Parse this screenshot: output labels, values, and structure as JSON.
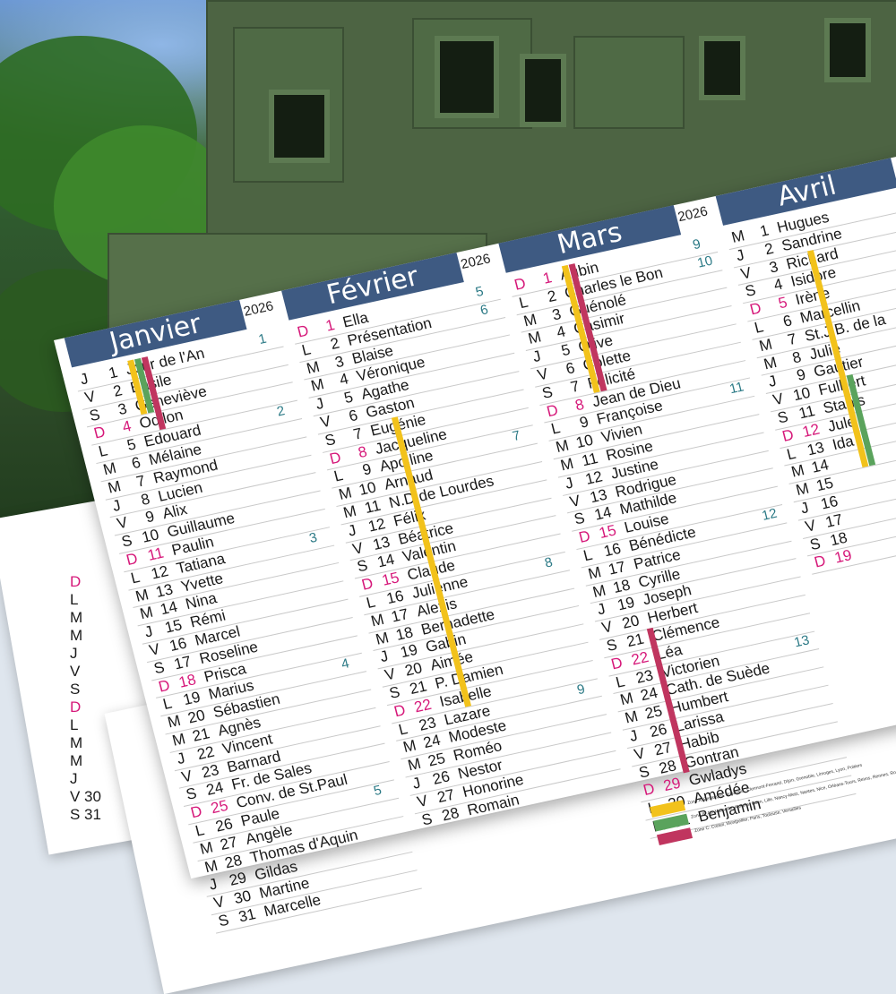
{
  "year": "2026",
  "months": [
    {
      "name": "Janvier",
      "days": [
        {
          "l": "J",
          "n": "1",
          "s": "Jour de l'An"
        },
        {
          "l": "V",
          "n": "2",
          "s": "Basile"
        },
        {
          "l": "S",
          "n": "3",
          "s": "Geneviève"
        },
        {
          "l": "D",
          "n": "4",
          "s": "Odilon"
        },
        {
          "l": "L",
          "n": "5",
          "s": "Edouard"
        },
        {
          "l": "M",
          "n": "6",
          "s": "Mélaine"
        },
        {
          "l": "M",
          "n": "7",
          "s": "Raymond"
        },
        {
          "l": "J",
          "n": "8",
          "s": "Lucien"
        },
        {
          "l": "V",
          "n": "9",
          "s": "Alix"
        },
        {
          "l": "S",
          "n": "10",
          "s": "Guillaume"
        },
        {
          "l": "D",
          "n": "11",
          "s": "Paulin"
        },
        {
          "l": "L",
          "n": "12",
          "s": "Tatiana"
        },
        {
          "l": "M",
          "n": "13",
          "s": "Yvette"
        },
        {
          "l": "M",
          "n": "14",
          "s": "Nina"
        },
        {
          "l": "J",
          "n": "15",
          "s": "Rémi"
        },
        {
          "l": "V",
          "n": "16",
          "s": "Marcel"
        },
        {
          "l": "S",
          "n": "17",
          "s": "Roseline"
        },
        {
          "l": "D",
          "n": "18",
          "s": "Prisca"
        },
        {
          "l": "L",
          "n": "19",
          "s": "Marius"
        },
        {
          "l": "M",
          "n": "20",
          "s": "Sébastien"
        },
        {
          "l": "M",
          "n": "21",
          "s": "Agnès"
        },
        {
          "l": "J",
          "n": "22",
          "s": "Vincent"
        },
        {
          "l": "V",
          "n": "23",
          "s": "Barnard"
        },
        {
          "l": "S",
          "n": "24",
          "s": "Fr. de Sales"
        },
        {
          "l": "D",
          "n": "25",
          "s": "Conv. de St.Paul"
        },
        {
          "l": "L",
          "n": "26",
          "s": "Paule"
        },
        {
          "l": "M",
          "n": "27",
          "s": "Angèle"
        },
        {
          "l": "M",
          "n": "28",
          "s": "Thomas d'Aquin"
        },
        {
          "l": "J",
          "n": "29",
          "s": "Gildas"
        },
        {
          "l": "V",
          "n": "30",
          "s": "Martine"
        },
        {
          "l": "S",
          "n": "31",
          "s": "Marcelle"
        }
      ],
      "weeks": [
        {
          "w": "1",
          "row": 0
        },
        {
          "w": "2",
          "row": 4
        },
        {
          "w": "3",
          "row": 11
        },
        {
          "w": "4",
          "row": 18
        },
        {
          "w": "5",
          "row": 25
        }
      ]
    },
    {
      "name": "Février",
      "days": [
        {
          "l": "D",
          "n": "1",
          "s": "Ella"
        },
        {
          "l": "L",
          "n": "2",
          "s": "Présentation"
        },
        {
          "l": "M",
          "n": "3",
          "s": "Blaise"
        },
        {
          "l": "M",
          "n": "4",
          "s": "Véronique"
        },
        {
          "l": "J",
          "n": "5",
          "s": "Agathe"
        },
        {
          "l": "V",
          "n": "6",
          "s": "Gaston"
        },
        {
          "l": "S",
          "n": "7",
          "s": "Eugénie"
        },
        {
          "l": "D",
          "n": "8",
          "s": "Jacqueline"
        },
        {
          "l": "L",
          "n": "9",
          "s": "Apolline"
        },
        {
          "l": "M",
          "n": "10",
          "s": "Arnaud"
        },
        {
          "l": "M",
          "n": "11",
          "s": "N.D de Lourdes"
        },
        {
          "l": "J",
          "n": "12",
          "s": "Félix"
        },
        {
          "l": "V",
          "n": "13",
          "s": "Béatrice"
        },
        {
          "l": "S",
          "n": "14",
          "s": "Valentin"
        },
        {
          "l": "D",
          "n": "15",
          "s": "Claude"
        },
        {
          "l": "L",
          "n": "16",
          "s": "Julienne"
        },
        {
          "l": "M",
          "n": "17",
          "s": "Alexis"
        },
        {
          "l": "M",
          "n": "18",
          "s": "Bernadette"
        },
        {
          "l": "J",
          "n": "19",
          "s": "Gabin"
        },
        {
          "l": "V",
          "n": "20",
          "s": "Aimée"
        },
        {
          "l": "S",
          "n": "21",
          "s": "P. Damien"
        },
        {
          "l": "D",
          "n": "22",
          "s": "Isabelle"
        },
        {
          "l": "L",
          "n": "23",
          "s": "Lazare"
        },
        {
          "l": "M",
          "n": "24",
          "s": "Modeste"
        },
        {
          "l": "M",
          "n": "25",
          "s": "Roméo"
        },
        {
          "l": "J",
          "n": "26",
          "s": "Nestor"
        },
        {
          "l": "V",
          "n": "27",
          "s": "Honorine"
        },
        {
          "l": "S",
          "n": "28",
          "s": "Romain"
        }
      ],
      "weeks": [
        {
          "w": "5",
          "row": 0
        },
        {
          "w": "6",
          "row": 1
        },
        {
          "w": "7",
          "row": 8
        },
        {
          "w": "8",
          "row": 15
        },
        {
          "w": "9",
          "row": 22
        }
      ]
    },
    {
      "name": "Mars",
      "days": [
        {
          "l": "D",
          "n": "1",
          "s": "Aubin"
        },
        {
          "l": "L",
          "n": "2",
          "s": "Charles le Bon"
        },
        {
          "l": "M",
          "n": "3",
          "s": "Guénolé"
        },
        {
          "l": "M",
          "n": "4",
          "s": "Casimir"
        },
        {
          "l": "J",
          "n": "5",
          "s": "Olive"
        },
        {
          "l": "V",
          "n": "6",
          "s": "Colette"
        },
        {
          "l": "S",
          "n": "7",
          "s": "Félicité"
        },
        {
          "l": "D",
          "n": "8",
          "s": "Jean de Dieu"
        },
        {
          "l": "L",
          "n": "9",
          "s": "Françoise"
        },
        {
          "l": "M",
          "n": "10",
          "s": "Vivien"
        },
        {
          "l": "M",
          "n": "11",
          "s": "Rosine"
        },
        {
          "l": "J",
          "n": "12",
          "s": "Justine"
        },
        {
          "l": "V",
          "n": "13",
          "s": "Rodrigue"
        },
        {
          "l": "S",
          "n": "14",
          "s": "Mathilde"
        },
        {
          "l": "D",
          "n": "15",
          "s": "Louise"
        },
        {
          "l": "L",
          "n": "16",
          "s": "Bénédicte"
        },
        {
          "l": "M",
          "n": "17",
          "s": "Patrice"
        },
        {
          "l": "M",
          "n": "18",
          "s": "Cyrille"
        },
        {
          "l": "J",
          "n": "19",
          "s": "Joseph"
        },
        {
          "l": "V",
          "n": "20",
          "s": "Herbert"
        },
        {
          "l": "S",
          "n": "21",
          "s": "Clémence"
        },
        {
          "l": "D",
          "n": "22",
          "s": "Léa"
        },
        {
          "l": "L",
          "n": "23",
          "s": "Victorien"
        },
        {
          "l": "M",
          "n": "24",
          "s": "Cath. de Suède"
        },
        {
          "l": "M",
          "n": "25",
          "s": "Humbert"
        },
        {
          "l": "J",
          "n": "26",
          "s": "Larissa"
        },
        {
          "l": "V",
          "n": "27",
          "s": "Habib"
        },
        {
          "l": "S",
          "n": "28",
          "s": "Gontran"
        },
        {
          "l": "D",
          "n": "29",
          "s": "Gwladys"
        },
        {
          "l": "L",
          "n": "30",
          "s": "Amédée"
        },
        {
          "l": "M",
          "n": "31",
          "s": "Benjamin"
        }
      ],
      "weeks": [
        {
          "w": "9",
          "row": 0
        },
        {
          "w": "10",
          "row": 1
        },
        {
          "w": "11",
          "row": 8
        },
        {
          "w": "12",
          "row": 15
        },
        {
          "w": "13",
          "row": 22
        }
      ]
    },
    {
      "name": "Avril",
      "days": [
        {
          "l": "M",
          "n": "1",
          "s": "Hugues"
        },
        {
          "l": "J",
          "n": "2",
          "s": "Sandrine"
        },
        {
          "l": "V",
          "n": "3",
          "s": "Richard"
        },
        {
          "l": "S",
          "n": "4",
          "s": "Isidore"
        },
        {
          "l": "D",
          "n": "5",
          "s": "Irène"
        },
        {
          "l": "L",
          "n": "6",
          "s": "Marcellin"
        },
        {
          "l": "M",
          "n": "7",
          "s": "St.J.B. de la"
        },
        {
          "l": "M",
          "n": "8",
          "s": "Julie"
        },
        {
          "l": "J",
          "n": "9",
          "s": "Gautier"
        },
        {
          "l": "V",
          "n": "10",
          "s": "Fulbert"
        },
        {
          "l": "S",
          "n": "11",
          "s": "Stanis"
        },
        {
          "l": "D",
          "n": "12",
          "s": "Jule"
        },
        {
          "l": "L",
          "n": "13",
          "s": "Ida"
        },
        {
          "l": "M",
          "n": "14",
          "s": ""
        },
        {
          "l": "M",
          "n": "15",
          "s": ""
        },
        {
          "l": "J",
          "n": "16",
          "s": ""
        },
        {
          "l": "V",
          "n": "17",
          "s": ""
        },
        {
          "l": "S",
          "n": "18",
          "s": ""
        },
        {
          "l": "D",
          "n": "19",
          "s": ""
        }
      ],
      "weeks": []
    }
  ],
  "legend": [
    {
      "color": "#f2c21b",
      "text": "Zone A: Besançon, Bordeaux, Clermont-Ferrand, Dijon, Grenoble, Limoges, Lyon, Poitiers"
    },
    {
      "color": "#5aa35c",
      "text": "Zone B: Aix-Marseille, Amiens, Caen, Lille, Nancy-Metz, Nantes, Nice, Orléans-Tours, Reims, Rennes, Rouen, Strasbourg"
    },
    {
      "color": "#c0355f",
      "text": "Zone C: Créteil, Montpellier, Paris, Toulouse, Versailles"
    }
  ],
  "colors": {
    "header": "#3e5a82",
    "sunday": "#d6197a",
    "week": "#2c7a86",
    "zoneA": "#f2c21b",
    "zoneB": "#5aa35c",
    "zoneC": "#c0355f"
  },
  "peek_left": [
    "D",
    "L",
    "M",
    "M",
    "J",
    "V",
    "S",
    "D",
    "L",
    "M",
    "M",
    "J",
    "V 30",
    "S 31"
  ],
  "peek_bottom": [
    {
      "a": "L 30",
      "b": "Amédée"
    },
    {
      "a": "M 31",
      "b": "Benjamin"
    }
  ]
}
